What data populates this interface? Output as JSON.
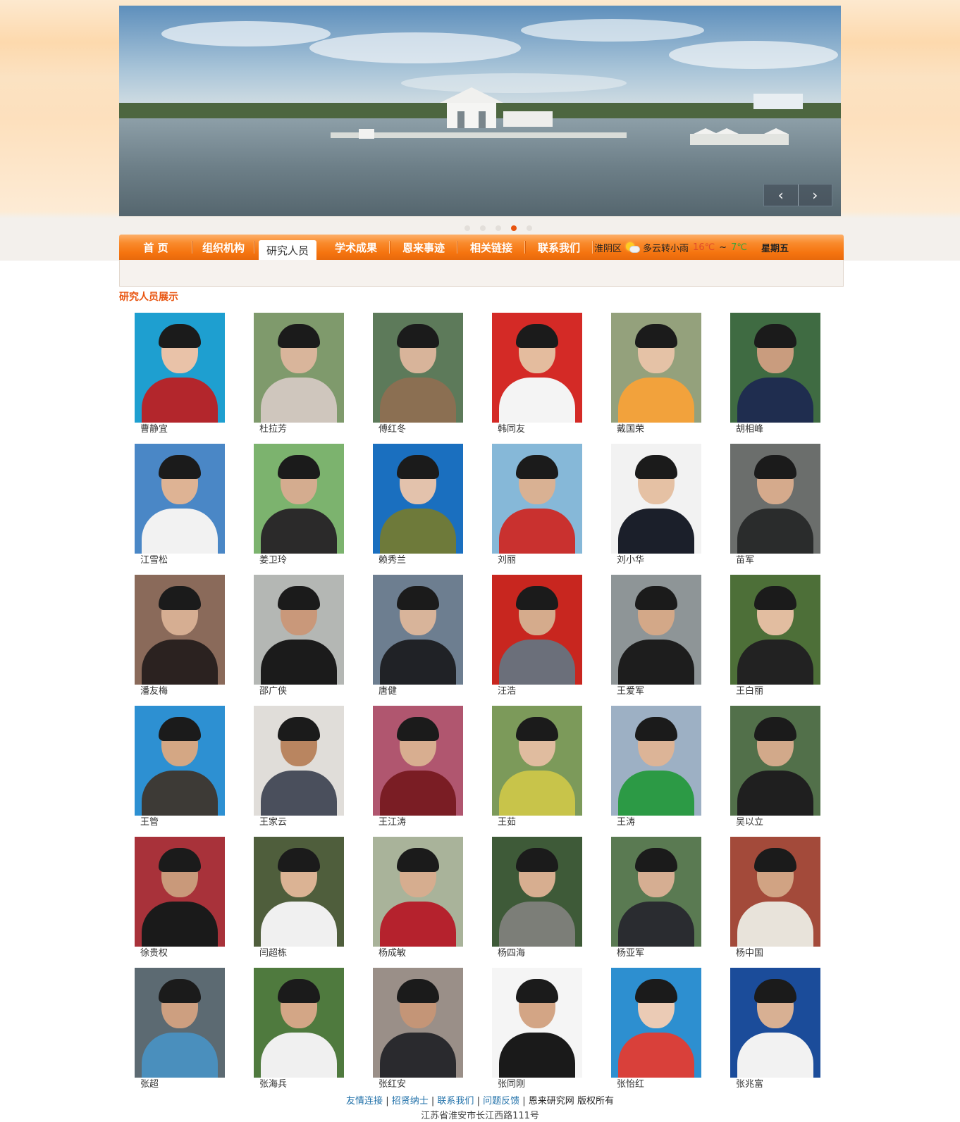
{
  "banner": {
    "prev_label": "‹",
    "next_label": "›",
    "dots": 5,
    "active_dot": 4
  },
  "nav": {
    "items": [
      {
        "label": "首 页"
      },
      {
        "label": "组织机构"
      },
      {
        "label": "研究人员",
        "active": true
      },
      {
        "label": "学术成果"
      },
      {
        "label": "恩来事迹"
      },
      {
        "label": "相关链接"
      },
      {
        "label": "联系我们"
      }
    ],
    "weather": {
      "district": "淮阴区",
      "condition": "多云转小雨",
      "temp_high": "16℃",
      "tilde": "~",
      "temp_low": "7℃",
      "weekday": "星期五"
    }
  },
  "section_title": "研究人员展示",
  "people": [
    {
      "name": "曹静宜",
      "bg": "#1e9fd0",
      "shirt": "#b3262c",
      "skin": "#e9c2a8"
    },
    {
      "name": "杜拉芳",
      "bg": "#7f9a6c",
      "shirt": "#cfc6bd",
      "skin": "#d9b59b"
    },
    {
      "name": "傅红冬",
      "bg": "#5d7a5a",
      "shirt": "#8b6f52",
      "skin": "#d8b49a"
    },
    {
      "name": "韩同友",
      "bg": "#d42a26",
      "shirt": "#f4f4f4",
      "skin": "#e4bc9e"
    },
    {
      "name": "戴国荣",
      "bg": "#94a17c",
      "shirt": "#f2a23c",
      "skin": "#e5c2a6"
    },
    {
      "name": "胡相峰",
      "bg": "#3f6b42",
      "shirt": "#1f2d4f",
      "skin": "#c99c7e"
    },
    {
      "name": "江雪松",
      "bg": "#4a87c6",
      "shirt": "#f2f2f2",
      "skin": "#deb394"
    },
    {
      "name": "姜卫玲",
      "bg": "#7cb36e",
      "shirt": "#2b2a2a",
      "skin": "#d4ac8f"
    },
    {
      "name": "赖秀兰",
      "bg": "#1a6fbf",
      "shirt": "#6e7a3a",
      "skin": "#e3c2ac"
    },
    {
      "name": "刘丽",
      "bg": "#86b8d8",
      "shirt": "#c9312f",
      "skin": "#d9b193"
    },
    {
      "name": "刘小华",
      "bg": "#f2f2f2",
      "shirt": "#1b1f2a",
      "skin": "#e5c1a4"
    },
    {
      "name": "苗军",
      "bg": "#6b6e6c",
      "shirt": "#2a2c2c",
      "skin": "#d5aa8c"
    },
    {
      "name": "潘友梅",
      "bg": "#8a6a5a",
      "shirt": "#2b2220",
      "skin": "#d6ae92"
    },
    {
      "name": "邵广侠",
      "bg": "#b4b7b4",
      "shirt": "#1b1b1b",
      "skin": "#c9987a"
    },
    {
      "name": "唐健",
      "bg": "#6d7e90",
      "shirt": "#202226",
      "skin": "#d8b49a"
    },
    {
      "name": "汪浩",
      "bg": "#c8261f",
      "shirt": "#6b6f7a",
      "skin": "#d5ab8c"
    },
    {
      "name": "王爱军",
      "bg": "#8e9597",
      "shirt": "#1d1d1d",
      "skin": "#d3a888"
    },
    {
      "name": "王白丽",
      "bg": "#4d6f38",
      "shirt": "#222222",
      "skin": "#e2bda0"
    },
    {
      "name": "王管",
      "bg": "#2d90d2",
      "shirt": "#3d3a36",
      "skin": "#d4a784"
    },
    {
      "name": "王家云",
      "bg": "#e0ddd9",
      "shirt": "#4a4f5c",
      "skin": "#b98560"
    },
    {
      "name": "王江涛",
      "bg": "#b0566f",
      "shirt": "#7a1d24",
      "skin": "#d8ae90"
    },
    {
      "name": "王茹",
      "bg": "#7c9a5a",
      "shirt": "#c8c44a",
      "skin": "#e0bc9f"
    },
    {
      "name": "王涛",
      "bg": "#9db0c4",
      "shirt": "#2c9a45",
      "skin": "#dcb497"
    },
    {
      "name": "吴以立",
      "bg": "#52704a",
      "shirt": "#1f1f1f",
      "skin": "#d2a98a"
    },
    {
      "name": "徐贵权",
      "bg": "#a8323a",
      "shirt": "#1a1a1a",
      "skin": "#c9997a"
    },
    {
      "name": "闫超栋",
      "bg": "#4f5e3c",
      "shirt": "#f0f0f0",
      "skin": "#dbb394"
    },
    {
      "name": "杨成敏",
      "bg": "#a9b39a",
      "shirt": "#b5222d",
      "skin": "#d6ad8f"
    },
    {
      "name": "杨四海",
      "bg": "#3e5a38",
      "shirt": "#7c7e78",
      "skin": "#d7ae90"
    },
    {
      "name": "杨亚军",
      "bg": "#5a7a52",
      "shirt": "#2a2c30",
      "skin": "#d6ae92"
    },
    {
      "name": "杨中国",
      "bg": "#a34a3a",
      "shirt": "#e8e3da",
      "skin": "#d1a383"
    },
    {
      "name": "张超",
      "bg": "#5c6a72",
      "shirt": "#4a8fbd",
      "skin": "#cd9f80"
    },
    {
      "name": "张海兵",
      "bg": "#4f7a3e",
      "shirt": "#f0f0f0",
      "skin": "#d3a686"
    },
    {
      "name": "张红安",
      "bg": "#9a8f88",
      "shirt": "#2a2a2e",
      "skin": "#c49577"
    },
    {
      "name": "张同刚",
      "bg": "#f5f5f5",
      "shirt": "#1a1a1a",
      "skin": "#d3a585"
    },
    {
      "name": "张怡红",
      "bg": "#2d8fd0",
      "shirt": "#d9403a",
      "skin": "#ebcbb5"
    },
    {
      "name": "张兆富",
      "bg": "#1b4c9a",
      "shirt": "#f2f2f2",
      "skin": "#d8b093"
    }
  ],
  "footer": {
    "links": [
      "友情连接",
      "招贤纳士",
      "联系我们",
      "问题反馈"
    ],
    "sep": "|",
    "site": "恩来研究网",
    "rights": "版权所有",
    "address": "江苏省淮安市长江西路111号"
  }
}
